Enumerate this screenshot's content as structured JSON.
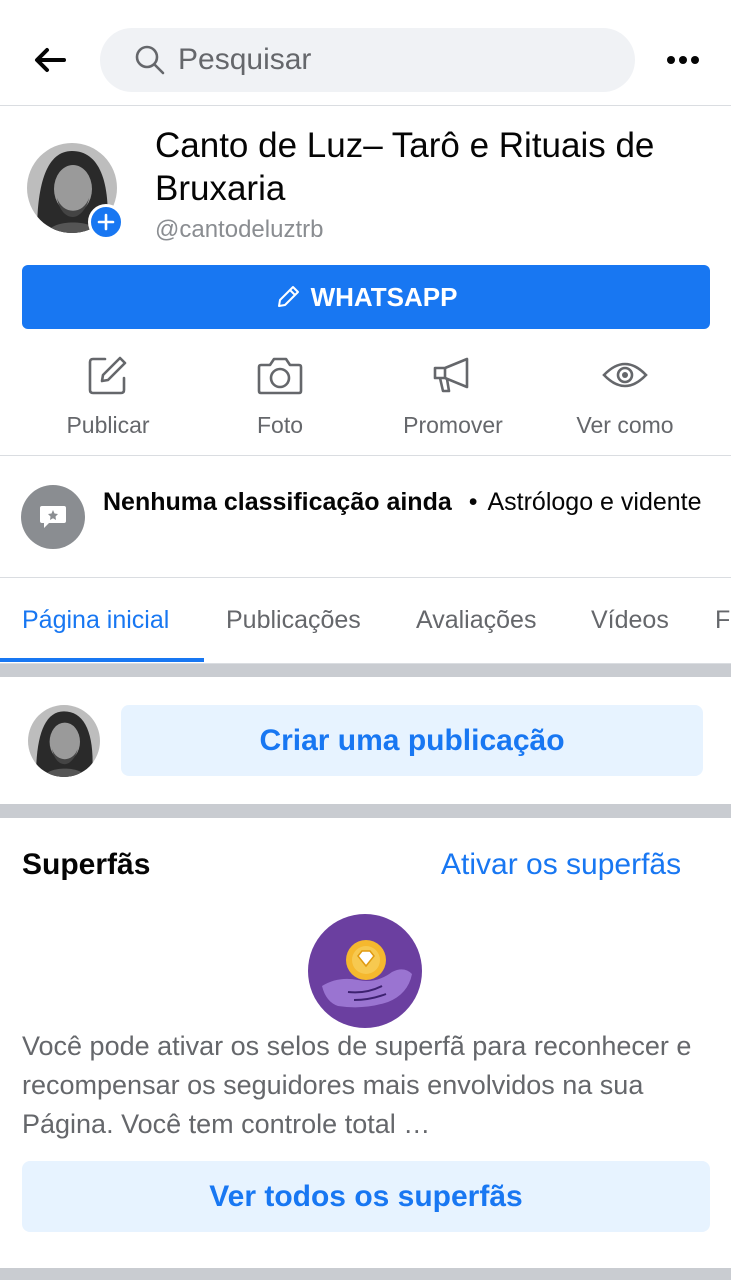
{
  "header": {
    "search_placeholder": "Pesquisar"
  },
  "profile": {
    "name": "Canto de Luz– Tarô e Rituais de Bruxaria",
    "handle": "@cantodeluztrb",
    "whatsapp_label": "WHATSAPP"
  },
  "actions": [
    {
      "label": "Publicar",
      "icon": "edit-icon"
    },
    {
      "label": "Foto",
      "icon": "camera-icon"
    },
    {
      "label": "Promover",
      "icon": "megaphone-icon"
    },
    {
      "label": "Ver como",
      "icon": "eye-icon"
    }
  ],
  "rating": {
    "bold": "Nenhuma classificação ainda",
    "dot": "•",
    "category": "Astrólogo e vidente"
  },
  "tabs": [
    {
      "label": "Página inicial",
      "active": true
    },
    {
      "label": "Publicações"
    },
    {
      "label": "Avaliações"
    },
    {
      "label": "Vídeos"
    },
    {
      "label": "F"
    }
  ],
  "composer": {
    "create_label": "Criar uma publicação"
  },
  "superfans": {
    "title": "Superfãs",
    "activate_link": "Ativar os superfãs",
    "description": "Você pode ativar os selos de superfã para reconhecer e recompensar os seguidores mais envolvidos na sua Página. Você tem controle total …",
    "view_all": "Ver todos os superfãs"
  },
  "colors": {
    "accent": "#1877f2",
    "accent_light": "#e7f3ff",
    "secondary_text": "#65676b",
    "divider": "#c9ccd1"
  }
}
